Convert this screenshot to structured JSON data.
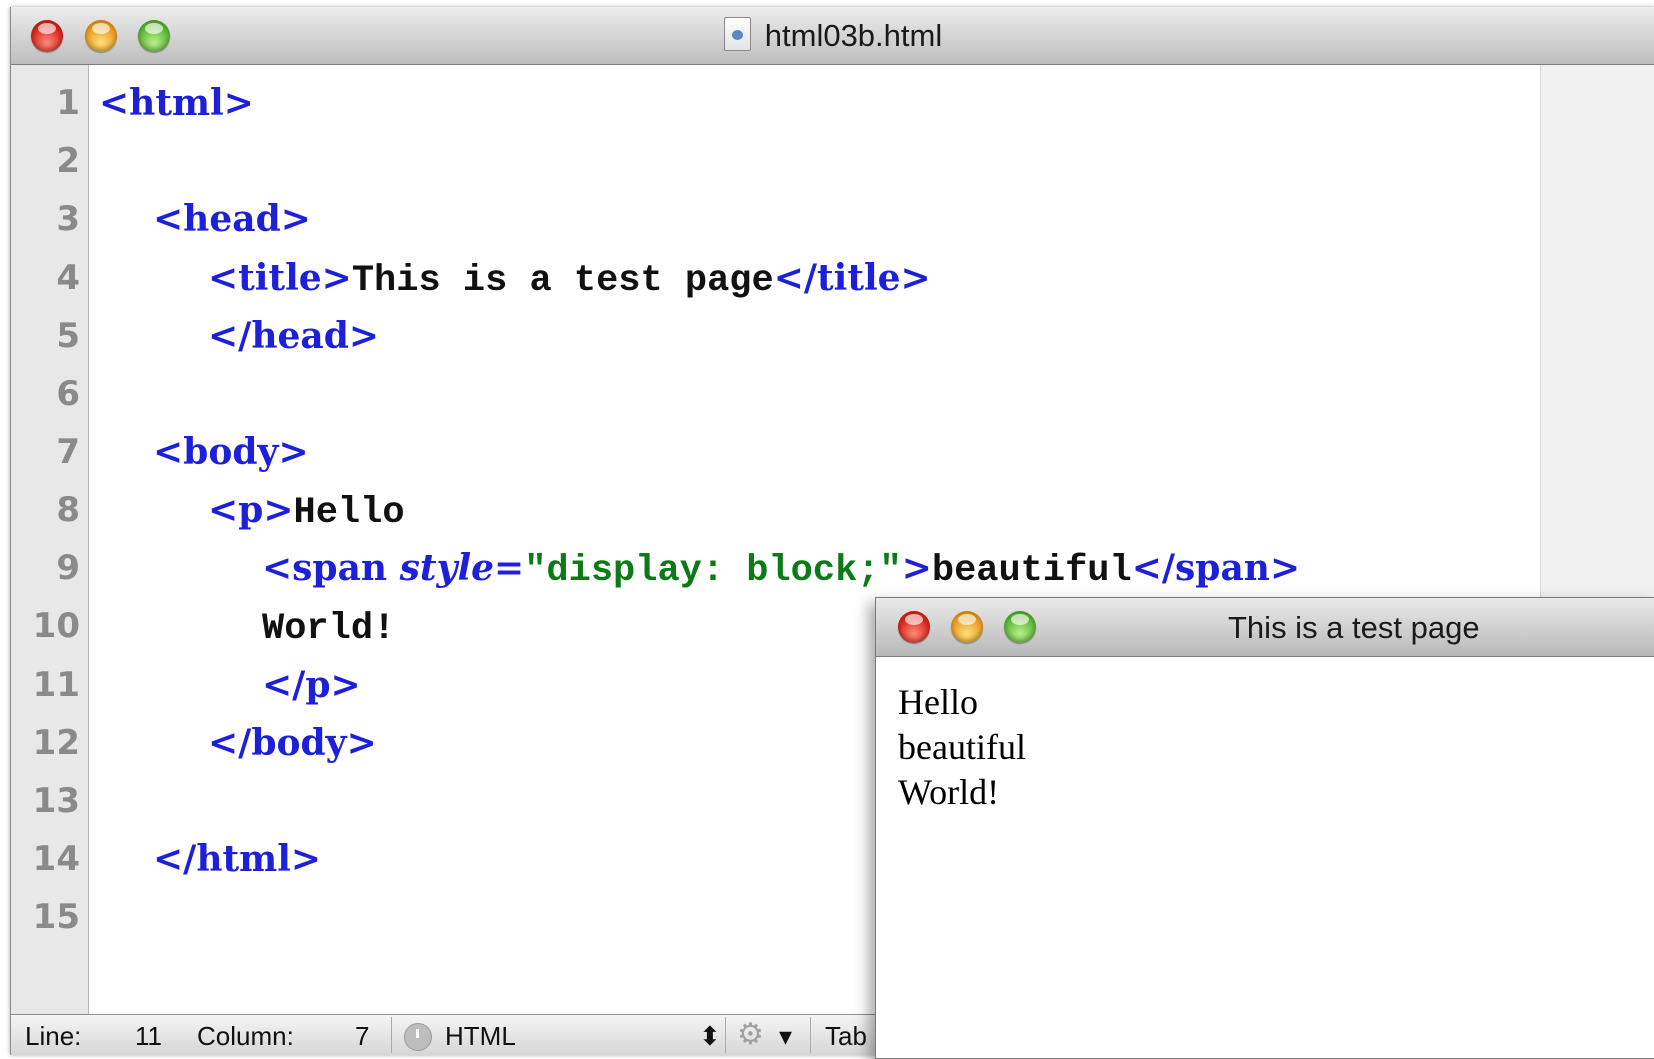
{
  "editor": {
    "filename": "html03b.html",
    "file_icon": "html-document-icon",
    "line_numbers": [
      "1",
      "2",
      "3",
      "4",
      "5",
      "6",
      "7",
      "8",
      "9",
      "10",
      "11",
      "12",
      "13",
      "14",
      "15"
    ],
    "code": {
      "l1": {
        "open": "<html>"
      },
      "l3": {
        "open": "<head>"
      },
      "l4": {
        "open": "<title>",
        "text": "This is a test page",
        "close": "</title>"
      },
      "l5": {
        "close": "</head>"
      },
      "l7": {
        "open": "<body>"
      },
      "l8": {
        "open": "<p>",
        "text": "Hello"
      },
      "l9": {
        "tag_start": "<span ",
        "attr_name": "style",
        "eq": "=",
        "attr_value": "\"display: block;\"",
        "tag_end": ">",
        "text": "beautiful",
        "close": "</span>"
      },
      "l10": {
        "text": "World!"
      },
      "l11": {
        "close": "</p>"
      },
      "l12": {
        "close": "</body>"
      },
      "l14": {
        "close": "</html>"
      }
    },
    "status": {
      "line_label": "Line:",
      "line_value": "11",
      "column_label": "Column:",
      "column_value": "7",
      "language": "HTML",
      "language_arrows": "⬍",
      "gear_menu_arrow": "▾",
      "tab_label": "Tab"
    }
  },
  "preview": {
    "title": "This is a test page",
    "lines": [
      "Hello",
      "beautiful",
      "World!"
    ]
  },
  "colors": {
    "tag": "#1d20d8",
    "string": "#0b7a17",
    "text": "#111111",
    "gutter": "#e8e8e8",
    "line_number": "#8a8a8a"
  }
}
